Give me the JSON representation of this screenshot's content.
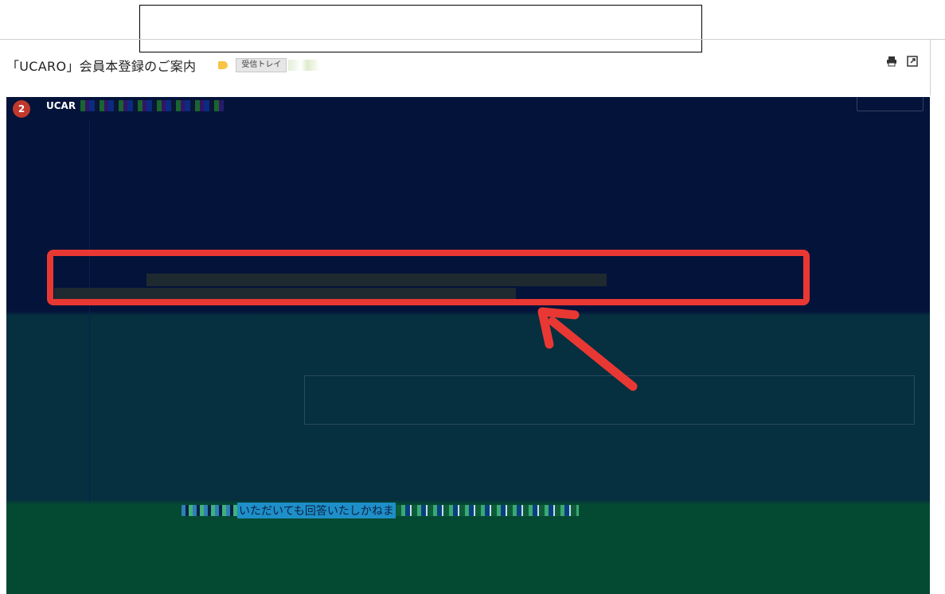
{
  "top_search": {
    "value": ""
  },
  "subject": "「UCARO」会員本登録のご案内",
  "label_chip": "受信トレイ",
  "icons": {
    "print": "printer-icon",
    "new_window": "open-in-new-window-icon",
    "label": "label-tag-icon",
    "avatar": "sender-avatar"
  },
  "message": {
    "avatar_letter": "2",
    "sender": "UCAR",
    "notice_text": "いただいても回答いたしかねま"
  },
  "colors": {
    "highlight": "#e93833",
    "body_top": "#03133a",
    "body_mid": "#062f3f",
    "body_bottom": "#044a33"
  }
}
